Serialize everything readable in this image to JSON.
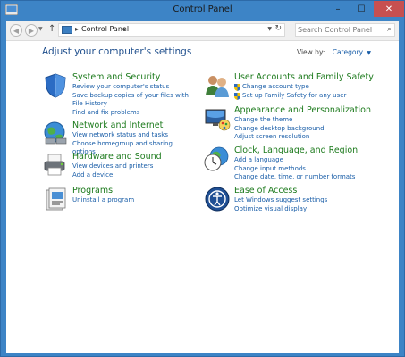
{
  "window": {
    "title": "Control Panel"
  },
  "window_controls": {
    "minimize": "–",
    "maximize": "☐",
    "close": "✕"
  },
  "addressbar": {
    "path": [
      "Control Panel"
    ],
    "search_placeholder": "Search Control Panel"
  },
  "header": {
    "heading": "Adjust your computer's settings",
    "view_by_label": "View by:",
    "view_by_value": "Category"
  },
  "categories": [
    {
      "title": "System and Security",
      "links": [
        "Review your computer's status",
        "Save backup copies of your files with File History",
        "Find and fix problems"
      ]
    },
    {
      "title": "Network and Internet",
      "links": [
        "View network status and tasks",
        "Choose homegroup and sharing options"
      ]
    },
    {
      "title": "Hardware and Sound",
      "links": [
        "View devices and printers",
        "Add a device"
      ]
    },
    {
      "title": "Programs",
      "links": [
        "Uninstall a program"
      ]
    },
    {
      "title": "User Accounts and Family Safety",
      "links": [
        "Change account type",
        "Set up Family Safety for any user"
      ]
    },
    {
      "title": "Appearance and Personalization",
      "links": [
        "Change the theme",
        "Change desktop background",
        "Adjust screen resolution"
      ]
    },
    {
      "title": "Clock, Language, and Region",
      "links": [
        "Add a language",
        "Change input methods",
        "Change date, time, or number formats"
      ]
    },
    {
      "title": "Ease of Access",
      "links": [
        "Let Windows suggest settings",
        "Optimize visual display"
      ]
    }
  ],
  "colors": {
    "title_bar": "#3d84c6",
    "link": "#1a5ea8",
    "category_title": "#1c7a1c",
    "heading": "#1e4e8c"
  }
}
